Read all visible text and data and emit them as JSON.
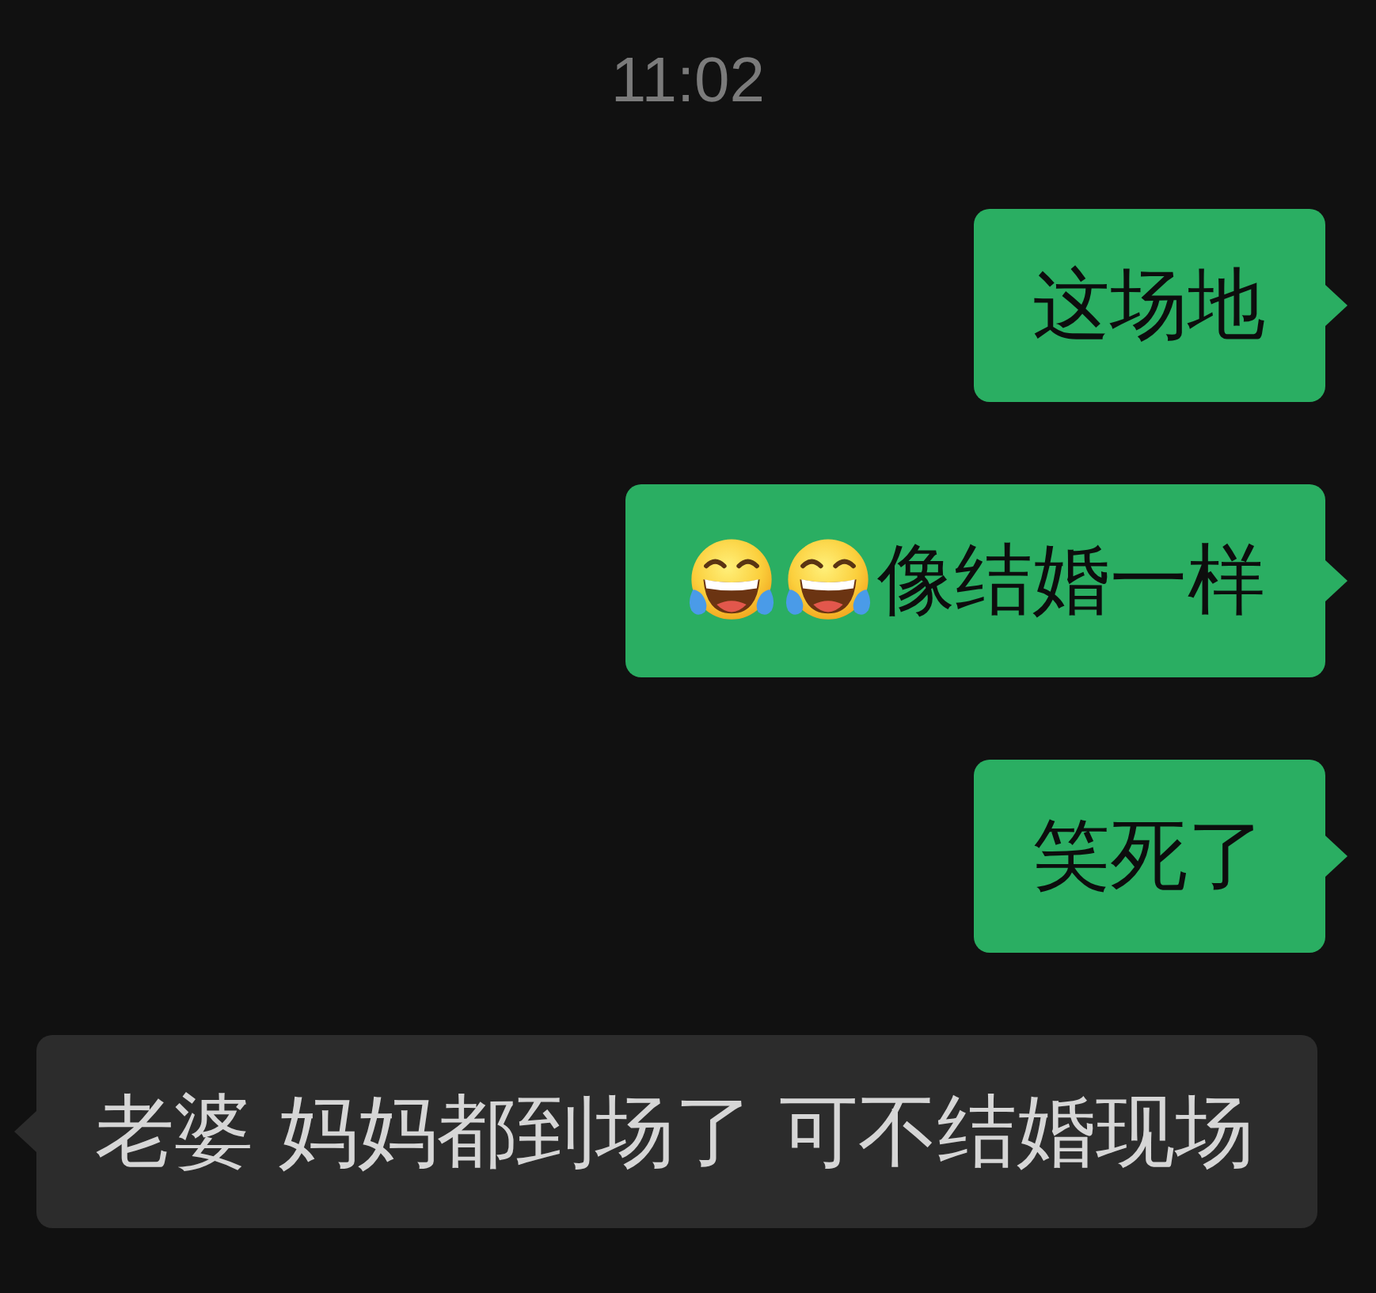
{
  "timestamp": "11:02",
  "messages": [
    {
      "kind": "sent",
      "text": "这场地"
    },
    {
      "kind": "sent",
      "emoji": [
        {
          "kind": "tears_of_joy"
        },
        {
          "kind": "tears_of_joy"
        }
      ],
      "text": "像结婚一样"
    },
    {
      "kind": "sent",
      "text": "笑死了"
    },
    {
      "kind": "received",
      "text": "老婆 妈妈都到场了 可不结婚现场"
    }
  ]
}
